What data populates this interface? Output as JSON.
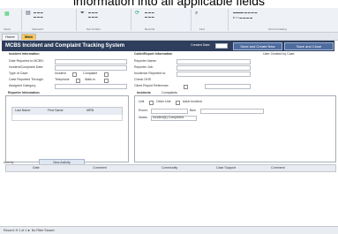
{
  "caption": "information into all applicable fields",
  "ribbon": {
    "groups": [
      "Views",
      "Clipboard",
      "Sort & Filter",
      "Records",
      "Find",
      "Text Formatting"
    ]
  },
  "doc_tabs": [
    "Home",
    "Main"
  ],
  "form": {
    "title": "MCBS Incident and Complaint Tracking System",
    "created_date_label": "Created Date:",
    "save_new_label": "Save and Create New",
    "save_close_label": "Save and Close",
    "section_incident": "Incident Information",
    "section_reporter": "Caller/Report Information",
    "user_created_label": "User Created by Case",
    "left_fields": [
      "Date Reported to MCBS:",
      "Incident/Complaint Date:",
      "Type of Case:",
      "Case Reported Through:",
      "Assigned Category"
    ],
    "case_type_options": [
      "Incident",
      "Complaint"
    ],
    "reported_options": [
      "Telephone",
      "Walk-in"
    ],
    "right_fields": [
      "Reporter Name:",
      "Reporter Job:",
      "Incidence Reported to:",
      "Check OHS",
      "Client Report Reference:"
    ],
    "tabs_left": [
      "Reporter Information"
    ],
    "tabs_right": [
      "Incidents",
      "Complaints"
    ],
    "reporter_columns": [
      "Last Name",
      "First Name",
      "MRN"
    ],
    "incidents_options": [
      "Unit",
      "Other Unit",
      "Adult Incident"
    ],
    "incident_fields": [
      "Room:",
      "Bed:",
      "Notes:"
    ],
    "notes_value": "Incident(s) Completed",
    "new_activity_label": "New Activity",
    "activity_label": "Activity",
    "activity_columns": [
      "Date",
      "Comment",
      "Community",
      "Case Support",
      "Comment"
    ],
    "status_record": "Record: H  1 of 1  ►  No Filter  Search"
  },
  "colors": {
    "header": "#2e3e5c",
    "accent_button": "#4f6c9e",
    "ribbon_bg": "#eef1f5"
  }
}
